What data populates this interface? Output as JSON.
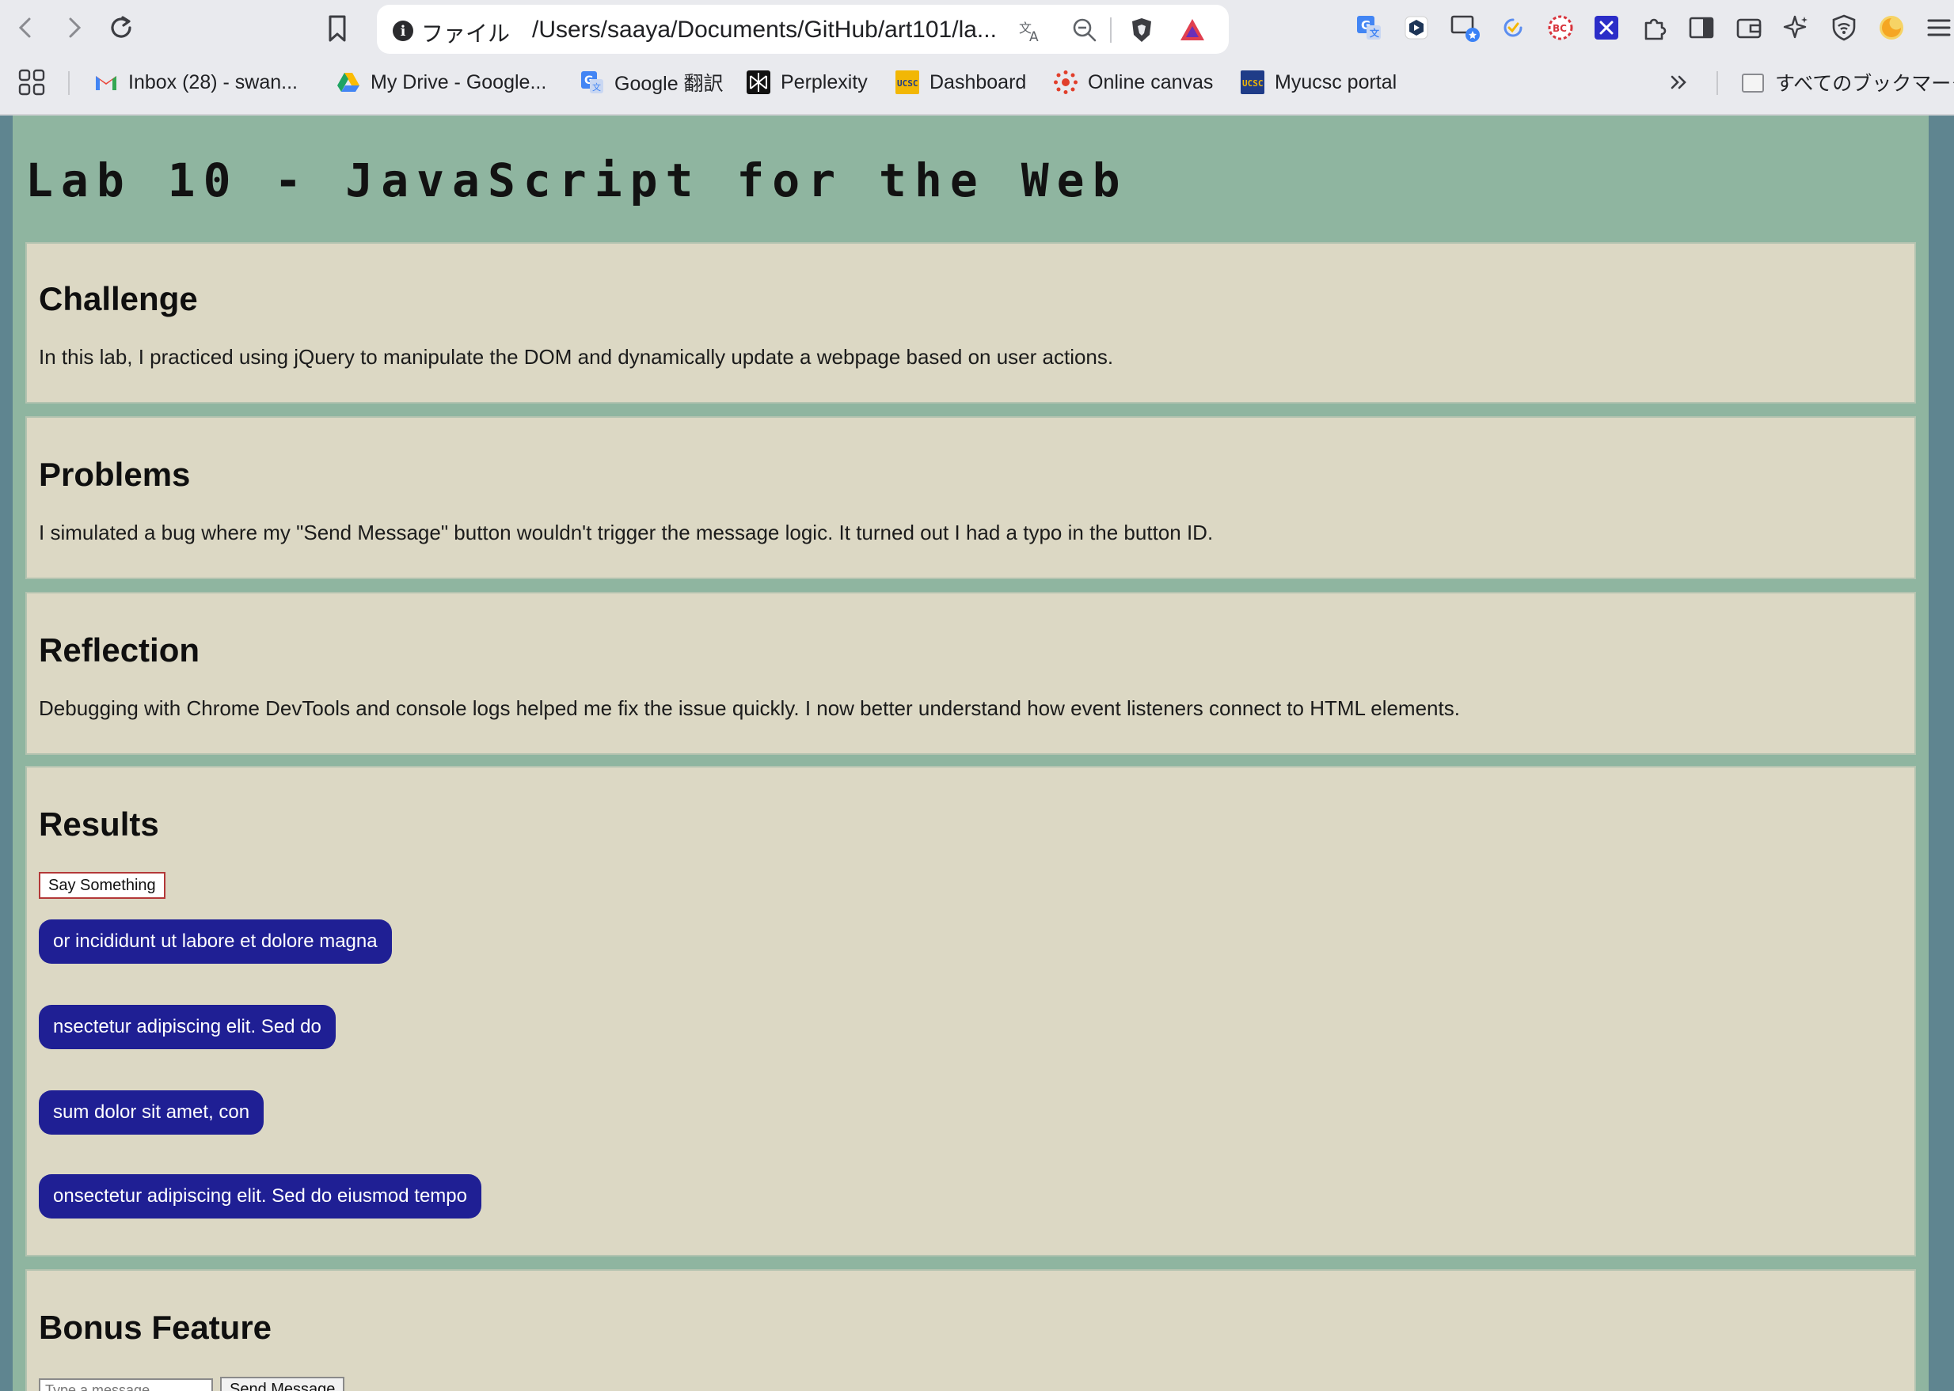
{
  "browser": {
    "url_scheme": "ファイル",
    "url": "/Users/saaya/Documents/GitHub/art101/la...",
    "bookmarks": [
      {
        "label": "Inbox (28) - swan...",
        "icon": "gmail-icon",
        "color": "#ea4335"
      },
      {
        "label": "My Drive - Google...",
        "icon": "google-drive-icon",
        "color": "#1fa463"
      },
      {
        "label": "Google 翻訳",
        "icon": "google-translate-icon",
        "color": "#4285f4"
      },
      {
        "label": "Perplexity",
        "icon": "perplexity-icon",
        "color": "#111111"
      },
      {
        "label": "Dashboard",
        "icon": "ucsc-icon",
        "color": "#f2b705"
      },
      {
        "label": "Online canvas",
        "icon": "canvas-icon",
        "color": "#e13f2b"
      },
      {
        "label": "Myucsc portal",
        "icon": "ucsc-portal-icon",
        "color": "#1f3c88"
      }
    ],
    "all_bookmarks_label": "すべてのブックマーク"
  },
  "page": {
    "title": "Lab 10 - JavaScript for the Web",
    "sections": {
      "challenge": {
        "heading": "Challenge",
        "text": "In this lab, I practiced using jQuery to manipulate the DOM and dynamically update a webpage based on user actions."
      },
      "problems": {
        "heading": "Problems",
        "text": "I simulated a bug where my \"Send Message\" button wouldn't trigger the message logic. It turned out I had a typo in the button ID."
      },
      "reflection": {
        "heading": "Reflection",
        "text": "Debugging with Chrome DevTools and console logs helped me fix the issue quickly. I now better understand how event listeners connect to HTML elements."
      },
      "results": {
        "heading": "Results",
        "button_label": "Say Something",
        "messages": [
          "or incididunt ut labore et dolore magna",
          "nsectetur adipiscing elit. Sed do",
          "sum dolor sit amet, con",
          "onsectetur adipiscing elit. Sed do eiusmod tempo"
        ]
      },
      "bonus": {
        "heading": "Bonus Feature",
        "input_placeholder": "Type a message...",
        "send_label": "Send Message"
      }
    }
  },
  "colors": {
    "page_background": "#8fb5a0",
    "card_background": "#dcd8c4",
    "bubble_background": "#1f1f94"
  }
}
